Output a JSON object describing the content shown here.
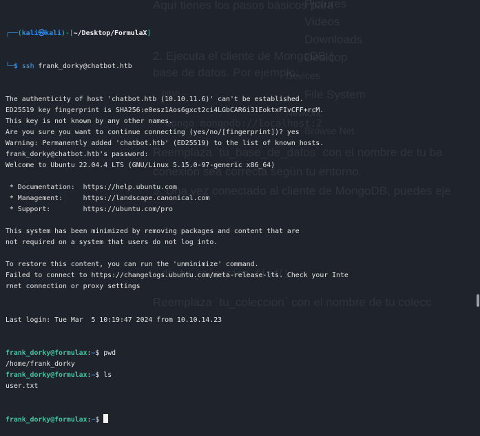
{
  "background_window": {
    "texts": [
      "Aquí tienes los pasos básicos para",
      "2. Ejecuta el cliente de MongoDB (",
      "base de datos. Por ejemplo:",
      "bash",
      "mongo mongodb://localhost:2",
      "Reemplaza `tu_base_de_datos` con el nombre de tu ba",
      "conexión sea correcta según tu entorno.",
      "3. Una vez conectado al cliente de MongoDB, puedes eje",
      "db.tu_coleccion.find()",
      "Reemplaza `tu_coleccion` con el nombre de tu colecc"
    ],
    "sidebar": [
      "Pictures",
      "Videos",
      "Downloads",
      "Desktop",
      "Devices",
      "File System",
      "Network",
      "Browse Net"
    ]
  },
  "terminal": {
    "prompt_header": {
      "user": "kali",
      "at": "㉿",
      "host": "kali",
      "path": "~/Desktop/FormulaX"
    },
    "command": {
      "name": "ssh",
      "args": " frank_dorky@chatbot.htb"
    },
    "output1": [
      "The authenticity of host 'chatbot.htb (10.10.11.6)' can't be established.",
      "ED25519 key fingerprint is SHA256:e0esz1Aos6gxct2ci4LGbCAR6i31EoktxFIvCFF+rcM.",
      "This key is not known by any other names.",
      "Are you sure you want to continue connecting (yes/no/[fingerprint])? yes",
      "Warning: Permanently added 'chatbot.htb' (ED25519) to the list of known hosts.",
      "frank_dorky@chatbot.htb's password: ",
      "Welcome to Ubuntu 22.04.4 LTS (GNU/Linux 5.15.0-97-generic x86_64)",
      "",
      " * Documentation:  https://help.ubuntu.com",
      " * Management:     https://landscape.canonical.com",
      " * Support:        https://ubuntu.com/pro",
      "",
      "This system has been minimized by removing packages and content that are",
      "not required on a system that users do not log into.",
      "",
      "To restore this content, you can run the 'unminimize' command.",
      "Failed to connect to https://changelogs.ubuntu.com/meta-release-lts. Check your Inte",
      "rnet connection or proxy settings",
      "",
      "",
      "Last login: Tue Mar  5 10:19:47 2024 from 10.10.14.23"
    ],
    "remote_prompt": {
      "userhost": "frank_dorky@formulax",
      "colon": ":",
      "dir": "~",
      "dollar": "$ "
    },
    "session": [
      {
        "cmd": "pwd",
        "output": "/home/frank_dorky"
      },
      {
        "cmd": "ls",
        "output": "user.txt"
      }
    ]
  }
}
